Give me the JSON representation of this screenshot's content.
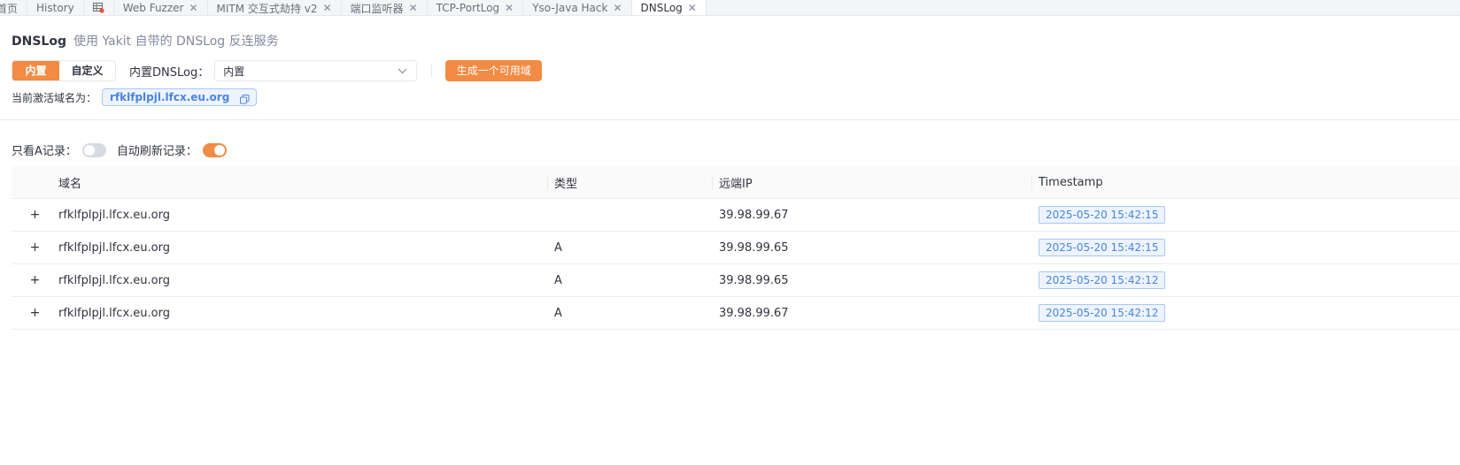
{
  "tabs": [
    {
      "label": "首页",
      "closable": false,
      "active": false
    },
    {
      "label": "History",
      "closable": false,
      "active": false
    },
    {
      "label": "",
      "icon": "table-grid-icon",
      "closable": false,
      "active": false
    },
    {
      "label": "Web Fuzzer",
      "closable": true,
      "active": false
    },
    {
      "label": "MITM 交互式劫持 v2",
      "closable": true,
      "active": false
    },
    {
      "label": "端口监听器",
      "closable": true,
      "active": false
    },
    {
      "label": "TCP-PortLog",
      "closable": true,
      "active": false
    },
    {
      "label": "Yso-Java Hack",
      "closable": true,
      "active": false
    },
    {
      "label": "DNSLog",
      "closable": true,
      "active": true
    }
  ],
  "header": {
    "title": "DNSLog",
    "subtitle": "使用 Yakit 自带的 DNSLog 反连服务"
  },
  "mode": {
    "builtin_label": "内置",
    "custom_label": "自定义",
    "selected": "内置"
  },
  "dnslog_select": {
    "label": "内置DNSLog：",
    "value": "内置"
  },
  "generate_button": "生成一个可用域名",
  "active_domain": {
    "label": "当前激活域名为：",
    "value": "rfklfplpjl.lfcx.eu.org"
  },
  "filters": {
    "only_a_label": "只看A记录：",
    "only_a_on": false,
    "auto_refresh_label": "自动刷新记录：",
    "auto_refresh_on": true
  },
  "table": {
    "columns": [
      "域名",
      "类型",
      "远端IP",
      "Timestamp"
    ],
    "rows": [
      {
        "domain": "rfklfplpjl.lfcx.eu.org",
        "type": "",
        "ip": "39.98.99.67",
        "timestamp": "2025-05-20 15:42:15"
      },
      {
        "domain": "rfklfplpjl.lfcx.eu.org",
        "type": "A",
        "ip": "39.98.99.65",
        "timestamp": "2025-05-20 15:42:15"
      },
      {
        "domain": "rfklfplpjl.lfcx.eu.org",
        "type": "A",
        "ip": "39.98.99.65",
        "timestamp": "2025-05-20 15:42:12"
      },
      {
        "domain": "rfklfplpjl.lfcx.eu.org",
        "type": "A",
        "ip": "39.98.99.67",
        "timestamp": "2025-05-20 15:42:12"
      }
    ]
  },
  "colors": {
    "accent": "#f28b44",
    "tag_blue": "#4a84e0"
  }
}
